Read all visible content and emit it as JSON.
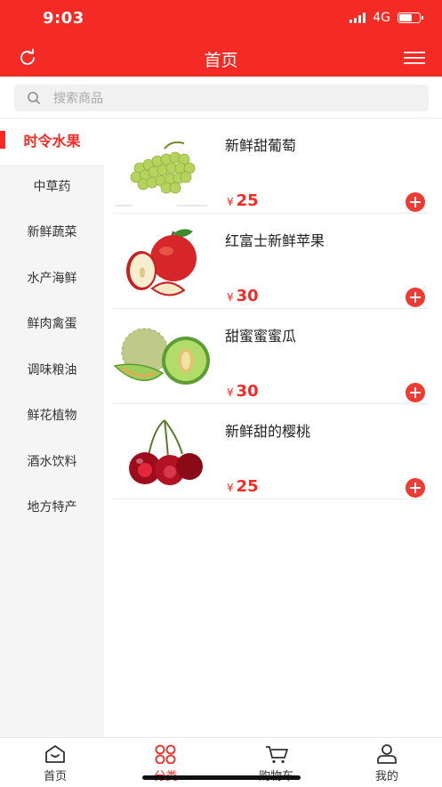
{
  "status_bar": {
    "time": "9:03",
    "network": "4G",
    "battery_level": 0.6
  },
  "header": {
    "title": "首页",
    "refresh_icon": "refresh-icon",
    "menu_icon": "menu-icon"
  },
  "search": {
    "placeholder": "搜索商品",
    "value": ""
  },
  "sidebar": {
    "items": [
      {
        "label": "时令水果",
        "active": true
      },
      {
        "label": "中草药",
        "active": false
      },
      {
        "label": "新鲜蔬菜",
        "active": false
      },
      {
        "label": "水产海鲜",
        "active": false
      },
      {
        "label": "鲜肉禽蛋",
        "active": false
      },
      {
        "label": "调味粮油",
        "active": false
      },
      {
        "label": "鲜花植物",
        "active": false
      },
      {
        "label": "酒水饮料",
        "active": false
      },
      {
        "label": "地方特产",
        "active": false
      }
    ]
  },
  "products": [
    {
      "name": "新鲜甜葡萄",
      "currency": "¥",
      "price": "25",
      "image": "grapes"
    },
    {
      "name": "红富士新鲜苹果",
      "currency": "¥",
      "price": "30",
      "image": "apple"
    },
    {
      "name": "甜蜜蜜蜜瓜",
      "currency": "¥",
      "price": "30",
      "image": "melon"
    },
    {
      "name": "新鲜甜的樱桃",
      "currency": "¥",
      "price": "25",
      "image": "cherries"
    }
  ],
  "tabbar": {
    "items": [
      {
        "label": "首页",
        "icon": "home-icon",
        "active": false
      },
      {
        "label": "分类",
        "icon": "category-icon",
        "active": true
      },
      {
        "label": "购物车",
        "icon": "cart-icon",
        "active": false
      },
      {
        "label": "我的",
        "icon": "profile-icon",
        "active": false
      }
    ]
  },
  "colors": {
    "accent": "#f42a24",
    "sidebar_bg": "#f5f5f5"
  }
}
